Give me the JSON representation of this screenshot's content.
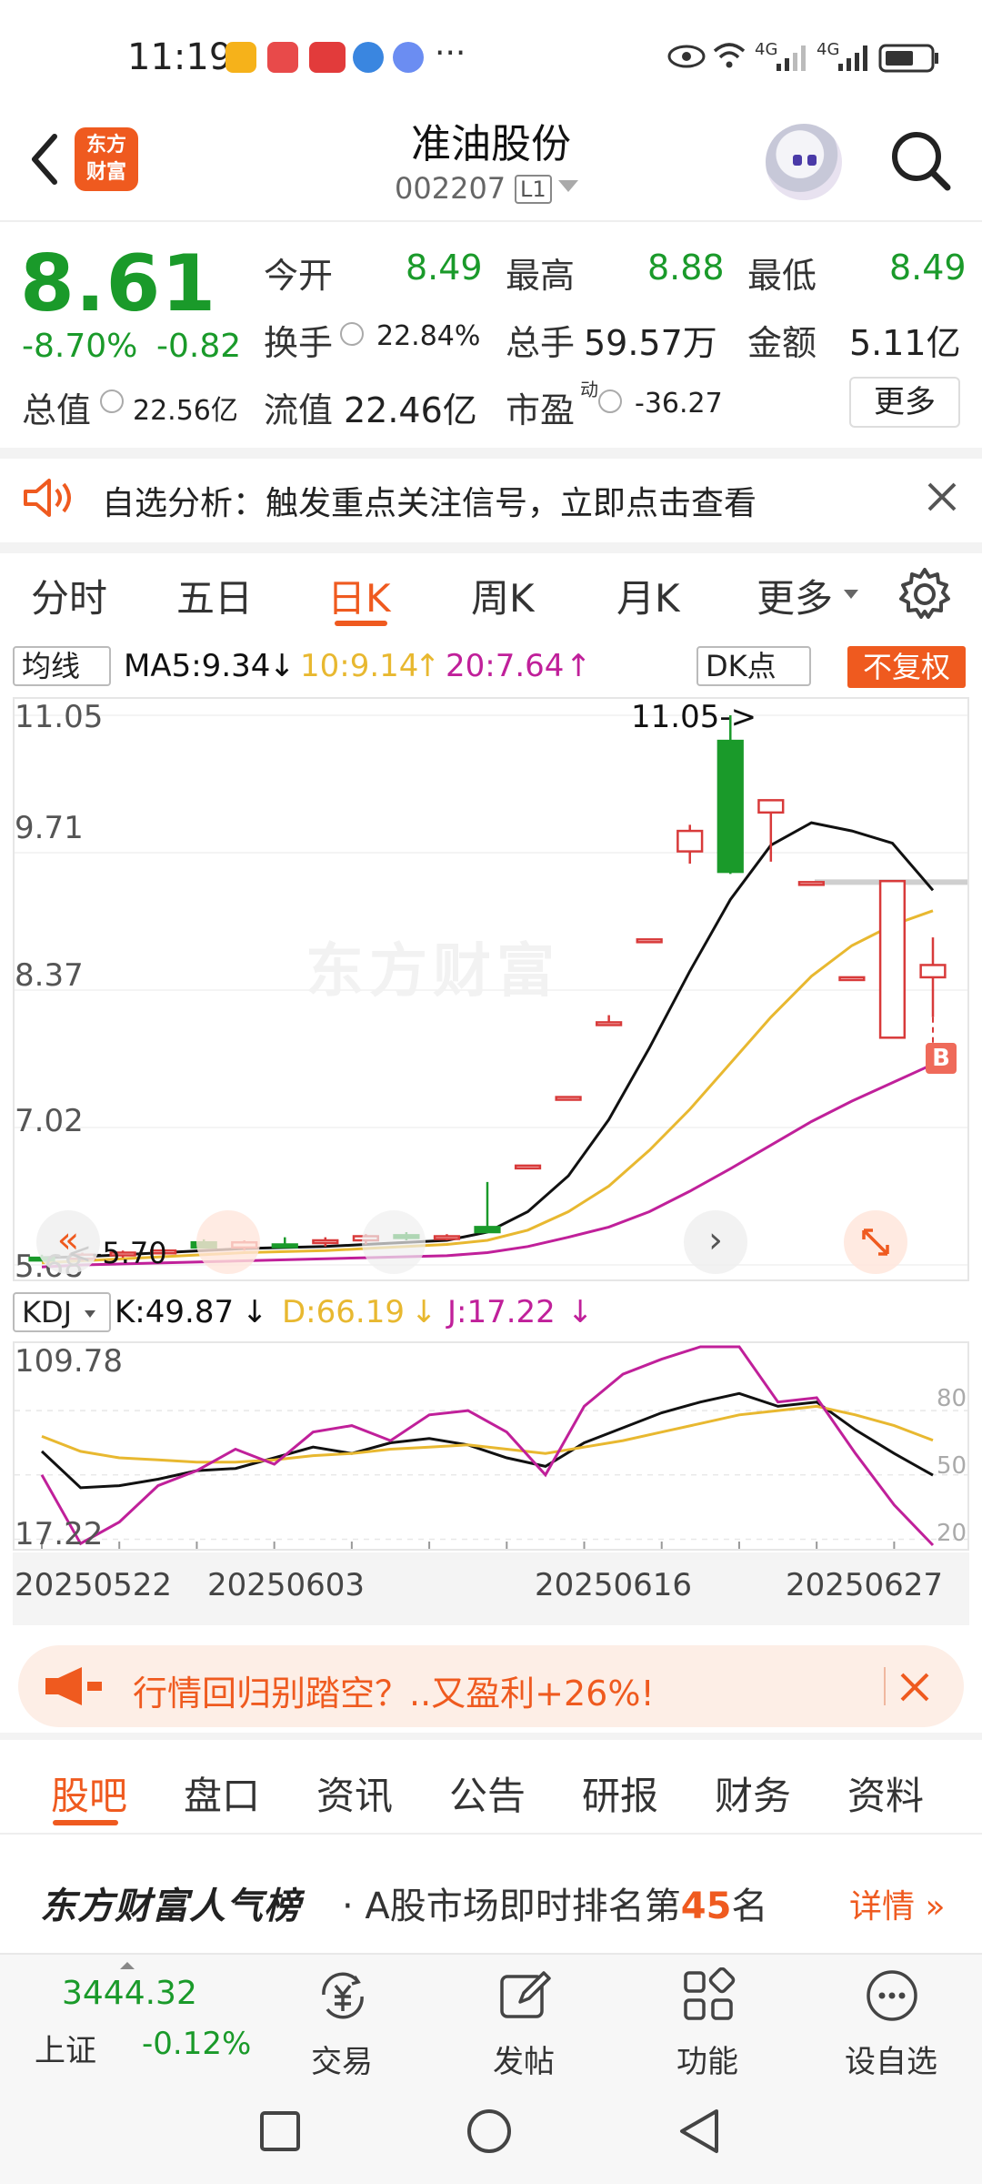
{
  "status_bar": {
    "time": "11:19",
    "more": "···",
    "signal_labels": [
      "4G",
      "4G"
    ]
  },
  "header": {
    "logo_lines": [
      "东方",
      "财富"
    ],
    "stock_name": "准油股份",
    "stock_code": "002207",
    "level_badge": "L1"
  },
  "quote": {
    "price": "8.61",
    "change_pct": "-8.70%",
    "change_abs": "-0.82",
    "rows": [
      [
        {
          "label": "今开",
          "value": "8.49"
        },
        {
          "label": "最高",
          "value": "8.88"
        },
        {
          "label": "最低",
          "value": "8.49"
        }
      ],
      [
        {
          "label": "换手",
          "value": "22.84%"
        },
        {
          "label": "总手",
          "value": "59.57万"
        },
        {
          "label": "金额",
          "value": "5.11亿"
        }
      ],
      [
        {
          "label": "总值",
          "value": "22.56亿"
        },
        {
          "label": "流值",
          "value": "22.46亿"
        },
        {
          "label": "市盈",
          "superscript": "动",
          "value": "-36.27"
        }
      ]
    ],
    "more_button": "更多"
  },
  "notice": {
    "text": "自选分析：触发重点关注信号，立即点击查看"
  },
  "chart_tabs": {
    "items": [
      "分时",
      "五日",
      "日K",
      "周K",
      "月K",
      "更多"
    ],
    "active_index": 2
  },
  "ma_bar": {
    "dropdown": "均线",
    "ma5": "MA5:9.34",
    "ma10": "10:9.14",
    "ma20": "20:7.64",
    "dk_button": "DK点",
    "adjust_button": "不复权"
  },
  "kdj_bar": {
    "dropdown": "KDJ",
    "k": "K:49.87",
    "d": "D:66.19",
    "j": "J:17.22"
  },
  "colors": {
    "accent": "#ef5a1f",
    "down_green": "#1a9a2a",
    "up_red": "#d83a3a",
    "ma5": "#111111",
    "ma10": "#e8b830",
    "ma20": "#c0209a"
  },
  "chart_data": [
    {
      "type": "candlestick",
      "ylim": [
        5.68,
        11.05
      ],
      "y_ticks": [
        "11.05",
        "9.71",
        "8.37",
        "7.02",
        "5.68"
      ],
      "annotations": {
        "high_label": "11.05->",
        "low_label": "<-5.70",
        "marker": "B"
      },
      "candles": [
        {
          "o": 5.75,
          "h": 5.78,
          "l": 5.72,
          "c": 5.74
        },
        {
          "o": 5.74,
          "h": 5.8,
          "l": 5.72,
          "c": 5.78
        },
        {
          "o": 5.78,
          "h": 5.82,
          "l": 5.75,
          "c": 5.8
        },
        {
          "o": 5.8,
          "h": 5.84,
          "l": 5.76,
          "c": 5.82
        },
        {
          "o": 5.9,
          "h": 5.93,
          "l": 5.84,
          "c": 5.85
        },
        {
          "o": 5.85,
          "h": 5.92,
          "l": 5.82,
          "c": 5.9
        },
        {
          "o": 5.88,
          "h": 5.95,
          "l": 5.85,
          "c": 5.86
        },
        {
          "o": 5.9,
          "h": 5.95,
          "l": 5.86,
          "c": 5.92
        },
        {
          "o": 5.92,
          "h": 5.98,
          "l": 5.88,
          "c": 5.96
        },
        {
          "o": 5.97,
          "h": 6.0,
          "l": 5.92,
          "c": 5.95
        },
        {
          "o": 5.95,
          "h": 5.98,
          "l": 5.92,
          "c": 5.96
        },
        {
          "o": 6.05,
          "h": 6.49,
          "l": 6.0,
          "c": 6.0
        },
        {
          "o": 6.65,
          "h": 6.65,
          "l": 6.64,
          "c": 6.65
        },
        {
          "o": 7.32,
          "h": 7.32,
          "l": 7.31,
          "c": 7.32
        },
        {
          "o": 8.05,
          "h": 8.12,
          "l": 8.04,
          "c": 8.05
        },
        {
          "o": 8.86,
          "h": 8.86,
          "l": 8.85,
          "c": 8.86
        },
        {
          "o": 9.72,
          "h": 9.98,
          "l": 9.6,
          "c": 9.92
        },
        {
          "o": 10.8,
          "h": 11.05,
          "l": 9.5,
          "c": 9.52
        },
        {
          "o": 10.1,
          "h": 10.2,
          "l": 9.62,
          "c": 10.22
        },
        {
          "o": 9.42,
          "h": 9.42,
          "l": 9.41,
          "c": 9.42
        },
        {
          "o": 8.49,
          "h": 8.49,
          "l": 8.48,
          "c": 8.49
        },
        {
          "o": 7.9,
          "h": 9.43,
          "l": 7.9,
          "c": 9.43
        },
        {
          "o": 8.49,
          "h": 8.88,
          "l": 8.1,
          "c": 8.61
        }
      ],
      "ma5": [
        5.75,
        5.76,
        5.78,
        5.8,
        5.82,
        5.84,
        5.85,
        5.86,
        5.88,
        5.9,
        5.92,
        6.0,
        6.2,
        6.55,
        7.1,
        7.8,
        8.55,
        9.25,
        9.78,
        10.0,
        9.92,
        9.8,
        9.34
      ],
      "ma10": [
        5.7,
        5.72,
        5.74,
        5.76,
        5.78,
        5.8,
        5.81,
        5.82,
        5.84,
        5.86,
        5.88,
        5.92,
        6.02,
        6.2,
        6.45,
        6.8,
        7.2,
        7.65,
        8.1,
        8.5,
        8.8,
        9.0,
        9.14
      ],
      "ma20": [
        5.66,
        5.68,
        5.69,
        5.7,
        5.71,
        5.72,
        5.73,
        5.74,
        5.75,
        5.76,
        5.77,
        5.8,
        5.86,
        5.95,
        6.05,
        6.2,
        6.4,
        6.62,
        6.85,
        7.08,
        7.28,
        7.46,
        7.64
      ]
    },
    {
      "type": "line",
      "title": "KDJ",
      "ylim": [
        17.22,
        109.78
      ],
      "y_ticks": [
        "109.78",
        "17.22"
      ],
      "ref_lines": [
        "80",
        "50",
        "20"
      ],
      "x_labels": [
        "20250522",
        "20250603",
        "20250616",
        "20250627"
      ],
      "series": [
        {
          "name": "K",
          "values": [
            61,
            44,
            45,
            48,
            52,
            53,
            58,
            63,
            60,
            65,
            67,
            64,
            58,
            54,
            65,
            72,
            79,
            84,
            88,
            82,
            84,
            71,
            60,
            49.87
          ]
        },
        {
          "name": "D",
          "values": [
            68,
            61,
            58,
            57,
            56,
            56,
            57,
            59,
            60,
            62,
            63,
            64,
            62,
            60,
            63,
            66,
            70,
            74,
            78,
            80,
            82,
            78,
            73,
            66.19
          ]
        },
        {
          "name": "J",
          "values": [
            50,
            18,
            28,
            45,
            52,
            62,
            55,
            70,
            73,
            66,
            78,
            80,
            70,
            50,
            82,
            97,
            104,
            110,
            110,
            84,
            86,
            60,
            36,
            17.22
          ]
        }
      ]
    }
  ],
  "promo": {
    "text": "行情回归别踏空？..又盈利+26%!"
  },
  "bottom_tabs": {
    "items": [
      "股吧",
      "盘口",
      "资讯",
      "公告",
      "研报",
      "财务",
      "资料"
    ],
    "active_index": 0
  },
  "rank": {
    "brand": "东方财富人气榜",
    "prefix": "· A股市场即时排名第",
    "number": "45",
    "suffix": "名",
    "detail": "详情"
  },
  "bottom_nav": {
    "index_value": "3444.32",
    "index_name": "上证",
    "index_change": "-0.12%",
    "items": [
      {
        "label": "交易",
        "icon": "yuan-exchange-icon"
      },
      {
        "label": "发帖",
        "icon": "edit-post-icon"
      },
      {
        "label": "功能",
        "icon": "grid-function-icon"
      },
      {
        "label": "设自选",
        "icon": "more-dots-icon"
      }
    ]
  }
}
